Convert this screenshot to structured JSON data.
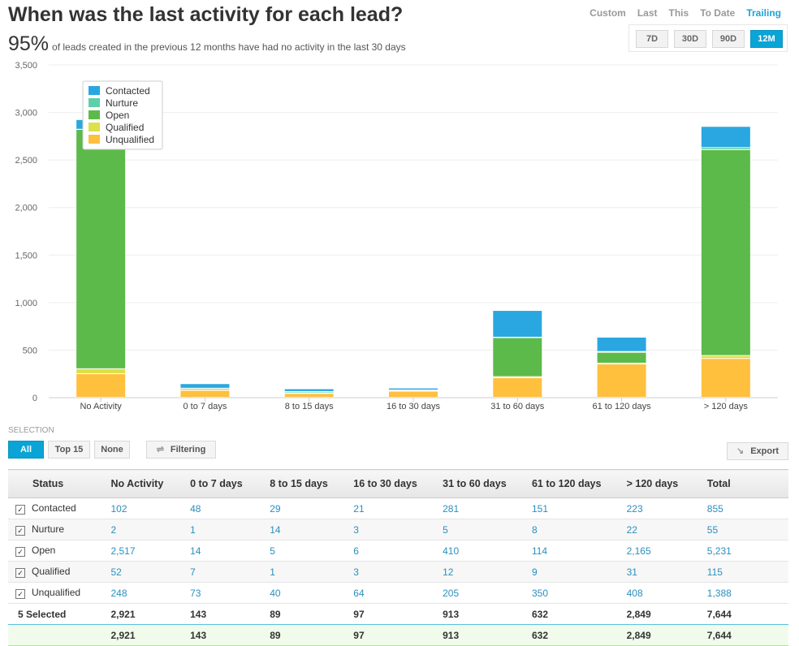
{
  "header": {
    "title": "When was the last activity for each lead?",
    "percent": "95%",
    "subtitle": "of leads created in the previous 12 months have had no activity in the last 30 days"
  },
  "periods": {
    "items": [
      "Custom",
      "Last",
      "This",
      "To Date",
      "Trailing"
    ],
    "active": "Trailing"
  },
  "ranges": {
    "items": [
      "7D",
      "30D",
      "90D",
      "12M"
    ],
    "active": "12M"
  },
  "chart_data": {
    "type": "bar",
    "stacked": true,
    "categories": [
      "No Activity",
      "0 to 7 days",
      "8 to 15 days",
      "16 to 30 days",
      "31 to 60 days",
      "61 to 120 days",
      "> 120 days"
    ],
    "ylim": [
      0,
      3500
    ],
    "yticks": [
      "0",
      "500",
      "1,000",
      "1,500",
      "2,000",
      "2,500",
      "3,000",
      "3,500"
    ],
    "grid": true,
    "legend": "top-left",
    "series": [
      {
        "name": "Unqualified",
        "color": "#ffc03e",
        "values": [
          248,
          73,
          40,
          64,
          205,
          350,
          408
        ]
      },
      {
        "name": "Qualified",
        "color": "#dde04a",
        "values": [
          52,
          7,
          1,
          3,
          12,
          9,
          31
        ]
      },
      {
        "name": "Open",
        "color": "#5cba4a",
        "values": [
          2517,
          14,
          5,
          6,
          410,
          114,
          2165
        ]
      },
      {
        "name": "Nurture",
        "color": "#5ecfa8",
        "values": [
          2,
          1,
          14,
          3,
          5,
          8,
          22
        ]
      },
      {
        "name": "Contacted",
        "color": "#2aa7e0",
        "values": [
          102,
          48,
          29,
          21,
          281,
          151,
          223
        ]
      }
    ]
  },
  "selection": {
    "label": "SELECTION",
    "all": "All",
    "top15": "Top 15",
    "none": "None",
    "filtering": "Filtering",
    "export": "Export"
  },
  "table": {
    "headers": [
      "Status",
      "No Activity",
      "0 to 7 days",
      "8 to 15 days",
      "16 to 30 days",
      "31 to 60 days",
      "61 to 120 days",
      "> 120 days",
      "Total"
    ],
    "rows": [
      [
        "Contacted",
        "102",
        "48",
        "29",
        "21",
        "281",
        "151",
        "223",
        "855"
      ],
      [
        "Nurture",
        "2",
        "1",
        "14",
        "3",
        "5",
        "8",
        "22",
        "55"
      ],
      [
        "Open",
        "2,517",
        "14",
        "5",
        "6",
        "410",
        "114",
        "2,165",
        "5,231"
      ],
      [
        "Qualified",
        "52",
        "7",
        "1",
        "3",
        "12",
        "9",
        "31",
        "115"
      ],
      [
        "Unqualified",
        "248",
        "73",
        "40",
        "64",
        "205",
        "350",
        "408",
        "1,388"
      ]
    ],
    "selected": [
      "5 Selected",
      "2,921",
      "143",
      "89",
      "97",
      "913",
      "632",
      "2,849",
      "7,644"
    ],
    "total": [
      "",
      "2,921",
      "143",
      "89",
      "97",
      "913",
      "632",
      "2,849",
      "7,644"
    ]
  }
}
